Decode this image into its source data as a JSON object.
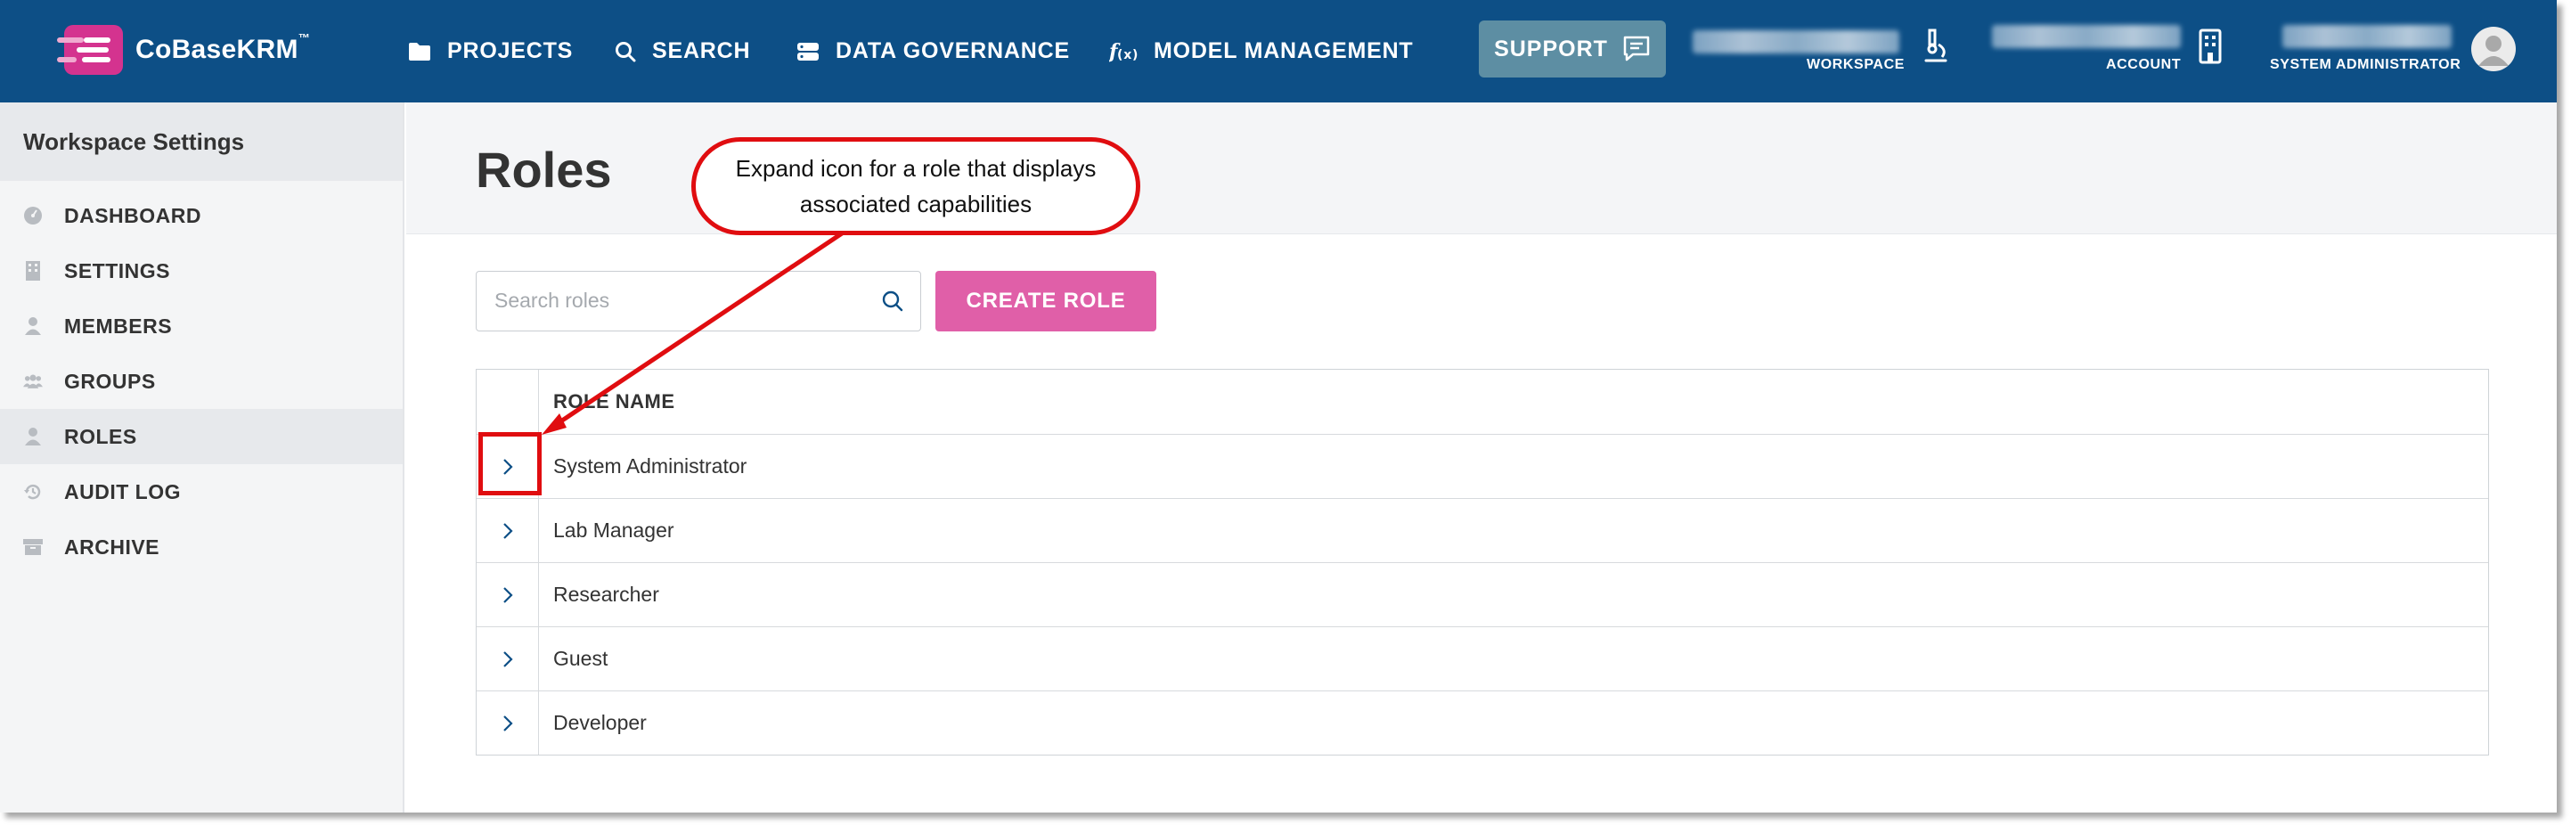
{
  "header": {
    "brand": "CoBaseKRM",
    "brand_tm": "™",
    "nav": [
      {
        "label": "PROJECTS",
        "icon": "folder-icon"
      },
      {
        "label": "SEARCH",
        "icon": "search-icon"
      },
      {
        "label": "DATA GOVERNANCE",
        "icon": "database-icon"
      },
      {
        "label": "MODEL MANAGEMENT",
        "icon": "function-icon"
      }
    ],
    "support_label": "SUPPORT",
    "workspace_label": "WORKSPACE",
    "account_label": "ACCOUNT",
    "user_role_label": "SYSTEM ADMINISTRATOR"
  },
  "sidebar": {
    "title": "Workspace Settings",
    "items": [
      {
        "label": "DASHBOARD",
        "icon": "dashboard-gauge-icon"
      },
      {
        "label": "SETTINGS",
        "icon": "building-icon"
      },
      {
        "label": "MEMBERS",
        "icon": "person-icon"
      },
      {
        "label": "GROUPS",
        "icon": "people-icon"
      },
      {
        "label": "ROLES",
        "icon": "person-icon",
        "active": true
      },
      {
        "label": "AUDIT LOG",
        "icon": "history-icon"
      },
      {
        "label": "ARCHIVE",
        "icon": "archive-box-icon"
      }
    ]
  },
  "main": {
    "title": "Roles",
    "search_placeholder": "Search roles",
    "create_button": "CREATE ROLE",
    "table": {
      "column_header": "ROLE NAME",
      "rows": [
        "System Administrator",
        "Lab Manager",
        "Researcher",
        "Guest",
        "Developer"
      ]
    }
  },
  "annotation": {
    "line1": "Expand icon for a role that displays",
    "line2": "associated capabilities"
  },
  "colors": {
    "header_bg": "#0d4f86",
    "accent_pink": "#e05fa8",
    "support_bg": "#5d8ea3",
    "annotation_red": "#e00d10"
  }
}
